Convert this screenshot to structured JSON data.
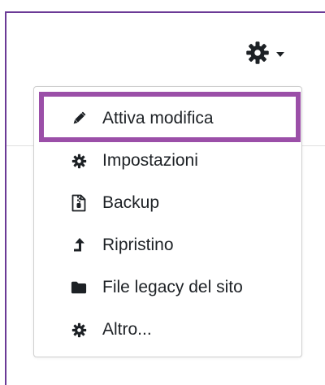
{
  "header": {
    "settings_icon": "gear-icon",
    "dropdown_icon": "caret-down-icon"
  },
  "menu": {
    "items": [
      {
        "label": "Attiva modifica",
        "icon": "pencil-icon",
        "highlighted": true
      },
      {
        "label": "Impostazioni",
        "icon": "gear-icon"
      },
      {
        "label": "Backup",
        "icon": "file-archive-icon"
      },
      {
        "label": "Ripristino",
        "icon": "restore-arrow-icon"
      },
      {
        "label": "File legacy del sito",
        "icon": "folder-icon"
      },
      {
        "label": "Altro...",
        "icon": "gear-icon"
      }
    ]
  },
  "colors": {
    "frame_border": "#6b3a96",
    "highlight_border": "#9b4fa8",
    "text": "#1d2125",
    "menu_border": "#cfcfcf"
  }
}
